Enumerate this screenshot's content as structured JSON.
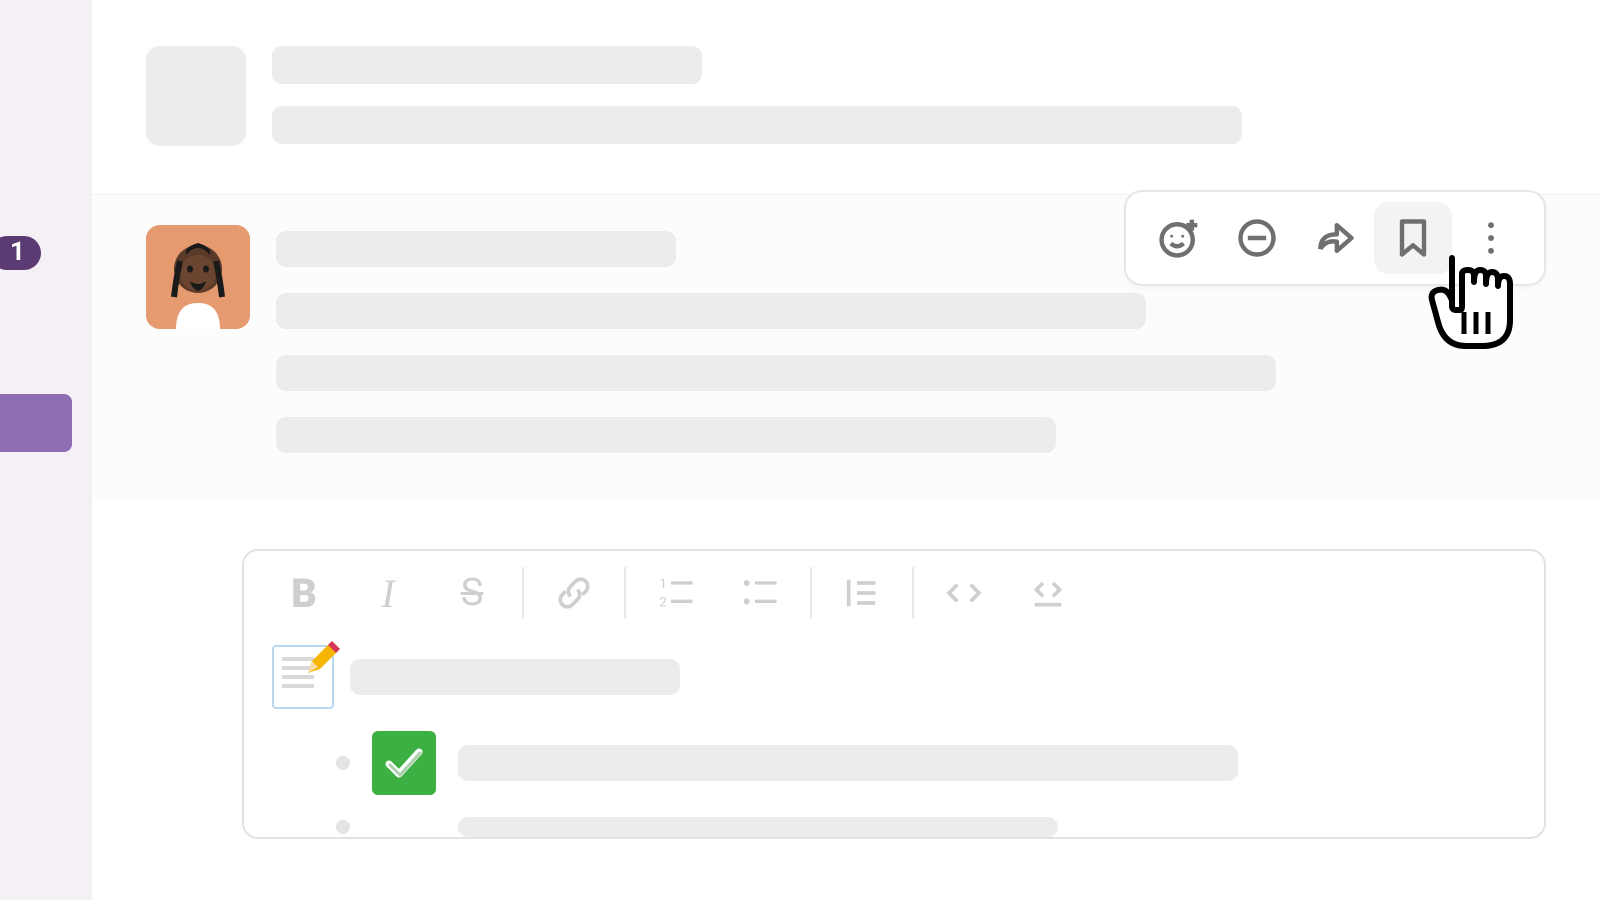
{
  "rail": {
    "badge_count": "1"
  },
  "hover_toolbar": {
    "buttons": [
      {
        "name": "add-reaction",
        "hovered": false
      },
      {
        "name": "reply-thread",
        "hovered": false
      },
      {
        "name": "share",
        "hovered": false
      },
      {
        "name": "bookmark",
        "hovered": true
      },
      {
        "name": "more-actions",
        "hovered": false
      }
    ]
  },
  "composer": {
    "format_buttons": [
      "bold",
      "italic",
      "strikethrough",
      "|",
      "link",
      "|",
      "ordered-list",
      "bulleted-list",
      "|",
      "blockquote",
      "|",
      "code",
      "code-block"
    ],
    "draft": {
      "memo_emoji": "memo",
      "check_emoji": "check-mark"
    }
  }
}
